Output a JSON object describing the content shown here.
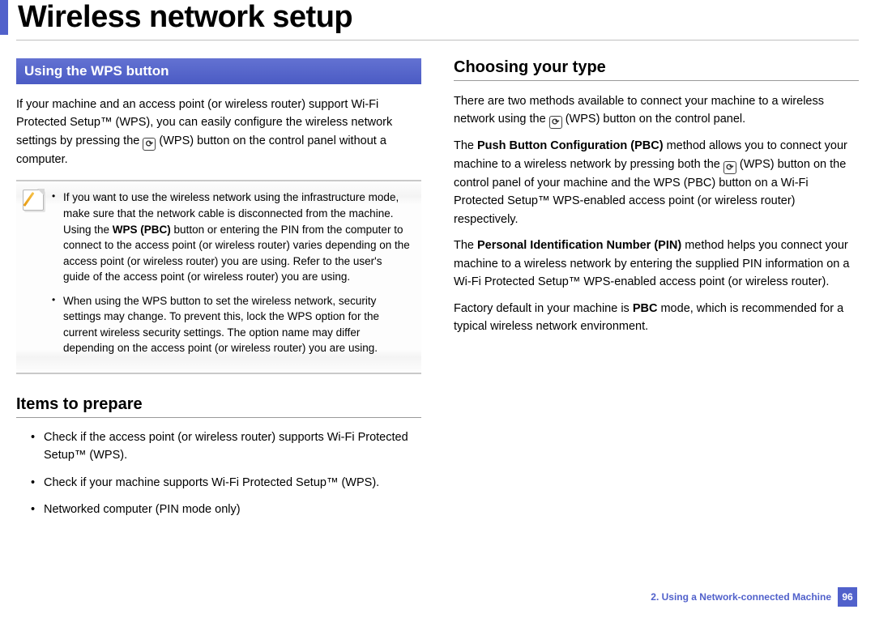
{
  "page_title": "Wireless network setup",
  "left": {
    "section_bar": "Using the WPS button",
    "intro_before_icon": "If your machine and an access point (or wireless router) support Wi-Fi Protected Setup™ (WPS), you can easily configure the wireless network settings by pressing the ",
    "wps_glyph": "⟳",
    "intro_after_icon": " (WPS) button on the control panel without a computer.",
    "note_items": [
      {
        "pre": "If you want to use the wireless network using the infrastructure mode, make sure that the network cable is disconnected from the machine. Using the ",
        "bold": "WPS (PBC)",
        "post": " button or entering the PIN from the computer to connect to the access point (or wireless router) varies depending on the access point (or wireless router) you are using. Refer to the user's guide of the access point (or wireless router) you are using."
      },
      {
        "pre": "When using the WPS button to set the wireless network, security settings may change. To prevent this, lock the WPS option for the current wireless security settings. The option name may differ depending on the access point (or wireless router) you are using.",
        "bold": "",
        "post": ""
      }
    ],
    "items_heading": "Items to prepare",
    "items": [
      "Check if the access point (or wireless router) supports Wi-Fi Protected Setup™ (WPS).",
      "Check if your machine supports Wi-Fi Protected Setup™ (WPS).",
      "Networked computer (PIN mode only)"
    ]
  },
  "right": {
    "heading": "Choosing your type",
    "p1_before": "There are two methods available to connect your machine to a wireless network using the ",
    "wps_glyph": "⟳",
    "p1_after": " (WPS) button on the control panel.",
    "p2_pre": "The ",
    "p2_bold": "Push Button Configuration (PBC)",
    "p2_mid": " method allows you to connect your machine to a wireless network by pressing both the ",
    "p2_after": " (WPS) button on the control panel of your machine and the WPS (PBC) button on a Wi-Fi Protected Setup™ WPS-enabled access point (or wireless router) respectively.",
    "p3_pre": "The ",
    "p3_bold": "Personal Identification Number (PIN)",
    "p3_post": " method helps you connect your machine to a wireless network by entering the supplied PIN information on a Wi-Fi Protected Setup™ WPS-enabled access point (or wireless router).",
    "p4_pre": "Factory default in your machine is ",
    "p4_bold": "PBC",
    "p4_post": " mode, which is recommended for a typical wireless network environment."
  },
  "footer": {
    "chapter": "2.  Using a Network-connected Machine",
    "page": "96"
  }
}
